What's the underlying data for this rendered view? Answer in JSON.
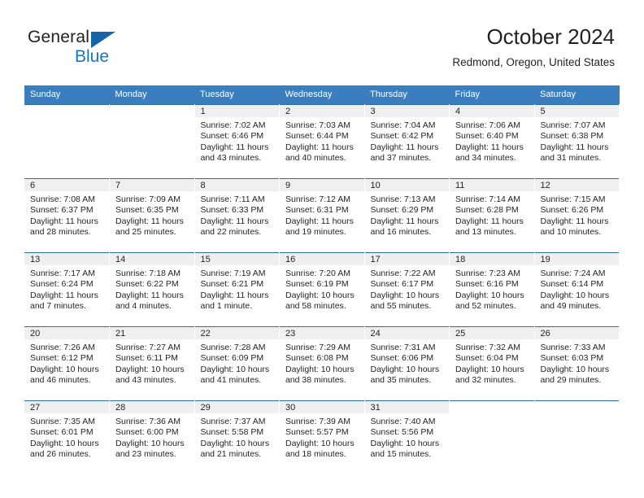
{
  "brand": {
    "name_part1": "General",
    "name_part2": "Blue",
    "triangle_color": "#1565a8",
    "blue_color": "#1577c4"
  },
  "header": {
    "title": "October 2024",
    "location": "Redmond, Oregon, United States"
  },
  "theme": {
    "header_row_bg": "#3a7ebf",
    "header_row_text": "#ffffff",
    "week_separator": "#2c6ca8",
    "daynum_band_bg": "#efefef",
    "text_color": "#231f20"
  },
  "weekdays": [
    "Sunday",
    "Monday",
    "Tuesday",
    "Wednesday",
    "Thursday",
    "Friday",
    "Saturday"
  ],
  "labels": {
    "sunrise_prefix": "Sunrise: ",
    "sunset_prefix": "Sunset: ",
    "daylight_prefix": "Daylight: "
  },
  "weeks": [
    [
      {
        "day": "",
        "sunrise": "",
        "sunset": "",
        "daylight": ""
      },
      {
        "day": "",
        "sunrise": "",
        "sunset": "",
        "daylight": ""
      },
      {
        "day": "1",
        "sunrise": "Sunrise: 7:02 AM",
        "sunset": "Sunset: 6:46 PM",
        "daylight": "Daylight: 11 hours and 43 minutes."
      },
      {
        "day": "2",
        "sunrise": "Sunrise: 7:03 AM",
        "sunset": "Sunset: 6:44 PM",
        "daylight": "Daylight: 11 hours and 40 minutes."
      },
      {
        "day": "3",
        "sunrise": "Sunrise: 7:04 AM",
        "sunset": "Sunset: 6:42 PM",
        "daylight": "Daylight: 11 hours and 37 minutes."
      },
      {
        "day": "4",
        "sunrise": "Sunrise: 7:06 AM",
        "sunset": "Sunset: 6:40 PM",
        "daylight": "Daylight: 11 hours and 34 minutes."
      },
      {
        "day": "5",
        "sunrise": "Sunrise: 7:07 AM",
        "sunset": "Sunset: 6:38 PM",
        "daylight": "Daylight: 11 hours and 31 minutes."
      }
    ],
    [
      {
        "day": "6",
        "sunrise": "Sunrise: 7:08 AM",
        "sunset": "Sunset: 6:37 PM",
        "daylight": "Daylight: 11 hours and 28 minutes."
      },
      {
        "day": "7",
        "sunrise": "Sunrise: 7:09 AM",
        "sunset": "Sunset: 6:35 PM",
        "daylight": "Daylight: 11 hours and 25 minutes."
      },
      {
        "day": "8",
        "sunrise": "Sunrise: 7:11 AM",
        "sunset": "Sunset: 6:33 PM",
        "daylight": "Daylight: 11 hours and 22 minutes."
      },
      {
        "day": "9",
        "sunrise": "Sunrise: 7:12 AM",
        "sunset": "Sunset: 6:31 PM",
        "daylight": "Daylight: 11 hours and 19 minutes."
      },
      {
        "day": "10",
        "sunrise": "Sunrise: 7:13 AM",
        "sunset": "Sunset: 6:29 PM",
        "daylight": "Daylight: 11 hours and 16 minutes."
      },
      {
        "day": "11",
        "sunrise": "Sunrise: 7:14 AM",
        "sunset": "Sunset: 6:28 PM",
        "daylight": "Daylight: 11 hours and 13 minutes."
      },
      {
        "day": "12",
        "sunrise": "Sunrise: 7:15 AM",
        "sunset": "Sunset: 6:26 PM",
        "daylight": "Daylight: 11 hours and 10 minutes."
      }
    ],
    [
      {
        "day": "13",
        "sunrise": "Sunrise: 7:17 AM",
        "sunset": "Sunset: 6:24 PM",
        "daylight": "Daylight: 11 hours and 7 minutes."
      },
      {
        "day": "14",
        "sunrise": "Sunrise: 7:18 AM",
        "sunset": "Sunset: 6:22 PM",
        "daylight": "Daylight: 11 hours and 4 minutes."
      },
      {
        "day": "15",
        "sunrise": "Sunrise: 7:19 AM",
        "sunset": "Sunset: 6:21 PM",
        "daylight": "Daylight: 11 hours and 1 minute."
      },
      {
        "day": "16",
        "sunrise": "Sunrise: 7:20 AM",
        "sunset": "Sunset: 6:19 PM",
        "daylight": "Daylight: 10 hours and 58 minutes."
      },
      {
        "day": "17",
        "sunrise": "Sunrise: 7:22 AM",
        "sunset": "Sunset: 6:17 PM",
        "daylight": "Daylight: 10 hours and 55 minutes."
      },
      {
        "day": "18",
        "sunrise": "Sunrise: 7:23 AM",
        "sunset": "Sunset: 6:16 PM",
        "daylight": "Daylight: 10 hours and 52 minutes."
      },
      {
        "day": "19",
        "sunrise": "Sunrise: 7:24 AM",
        "sunset": "Sunset: 6:14 PM",
        "daylight": "Daylight: 10 hours and 49 minutes."
      }
    ],
    [
      {
        "day": "20",
        "sunrise": "Sunrise: 7:26 AM",
        "sunset": "Sunset: 6:12 PM",
        "daylight": "Daylight: 10 hours and 46 minutes."
      },
      {
        "day": "21",
        "sunrise": "Sunrise: 7:27 AM",
        "sunset": "Sunset: 6:11 PM",
        "daylight": "Daylight: 10 hours and 43 minutes."
      },
      {
        "day": "22",
        "sunrise": "Sunrise: 7:28 AM",
        "sunset": "Sunset: 6:09 PM",
        "daylight": "Daylight: 10 hours and 41 minutes."
      },
      {
        "day": "23",
        "sunrise": "Sunrise: 7:29 AM",
        "sunset": "Sunset: 6:08 PM",
        "daylight": "Daylight: 10 hours and 38 minutes."
      },
      {
        "day": "24",
        "sunrise": "Sunrise: 7:31 AM",
        "sunset": "Sunset: 6:06 PM",
        "daylight": "Daylight: 10 hours and 35 minutes."
      },
      {
        "day": "25",
        "sunrise": "Sunrise: 7:32 AM",
        "sunset": "Sunset: 6:04 PM",
        "daylight": "Daylight: 10 hours and 32 minutes."
      },
      {
        "day": "26",
        "sunrise": "Sunrise: 7:33 AM",
        "sunset": "Sunset: 6:03 PM",
        "daylight": "Daylight: 10 hours and 29 minutes."
      }
    ],
    [
      {
        "day": "27",
        "sunrise": "Sunrise: 7:35 AM",
        "sunset": "Sunset: 6:01 PM",
        "daylight": "Daylight: 10 hours and 26 minutes."
      },
      {
        "day": "28",
        "sunrise": "Sunrise: 7:36 AM",
        "sunset": "Sunset: 6:00 PM",
        "daylight": "Daylight: 10 hours and 23 minutes."
      },
      {
        "day": "29",
        "sunrise": "Sunrise: 7:37 AM",
        "sunset": "Sunset: 5:58 PM",
        "daylight": "Daylight: 10 hours and 21 minutes."
      },
      {
        "day": "30",
        "sunrise": "Sunrise: 7:39 AM",
        "sunset": "Sunset: 5:57 PM",
        "daylight": "Daylight: 10 hours and 18 minutes."
      },
      {
        "day": "31",
        "sunrise": "Sunrise: 7:40 AM",
        "sunset": "Sunset: 5:56 PM",
        "daylight": "Daylight: 10 hours and 15 minutes."
      },
      {
        "day": "",
        "sunrise": "",
        "sunset": "",
        "daylight": ""
      },
      {
        "day": "",
        "sunrise": "",
        "sunset": "",
        "daylight": ""
      }
    ]
  ]
}
